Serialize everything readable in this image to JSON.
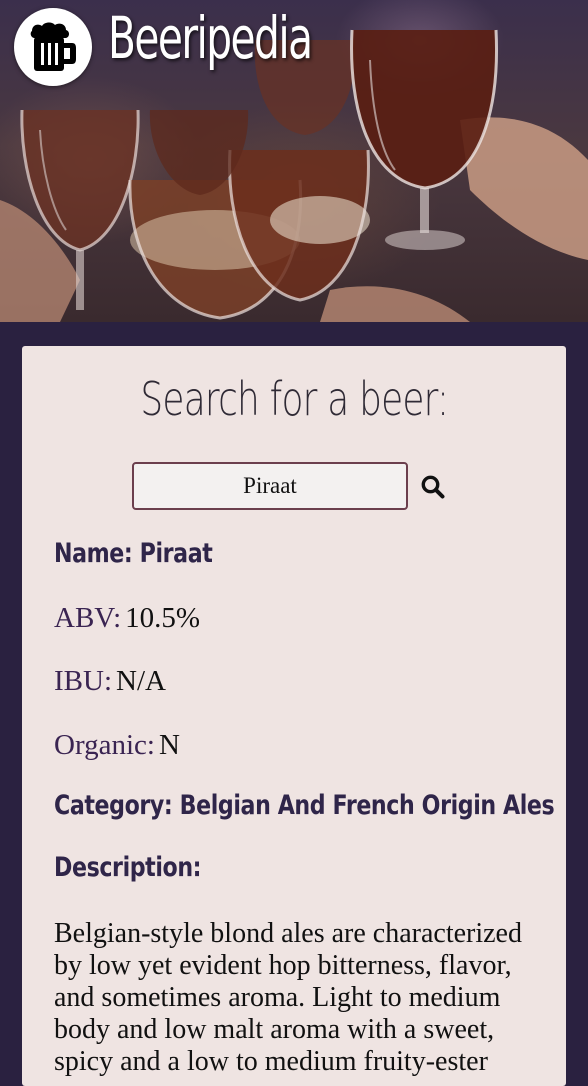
{
  "header": {
    "title": "Beeripedia",
    "logo_icon": "beer-mug-icon"
  },
  "search": {
    "heading": "Search for a beer:",
    "value": "Piraat",
    "button_icon": "search-icon"
  },
  "beer": {
    "name_label": "Name:",
    "name": "Piraat",
    "abv_label": "ABV:",
    "abv": "10.5%",
    "ibu_label": "IBU:",
    "ibu": "N/A",
    "organic_label": "Organic:",
    "organic": "N",
    "category_label": "Category:",
    "category": "Belgian And French Origin Ales",
    "description_label": "Description:",
    "description": "Belgian-style blond ales are characterized by low yet evident hop bitterness, flavor, and sometimes aroma. Light to medium body and low malt aroma with a sweet, spicy and a low to medium fruity-ester"
  },
  "colors": {
    "page_background": "#2a2140",
    "card_background": "#efe4e2",
    "label_color": "#2f2549",
    "input_border": "#6b3f4d"
  }
}
